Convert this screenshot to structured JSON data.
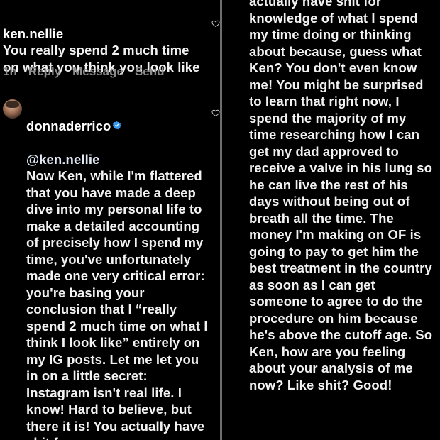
{
  "colors": {
    "background": "#000000",
    "text": "#f2f2f2",
    "meta": "#8e8e8e",
    "verified": "#3797f0",
    "divider": "#6e6e6e"
  },
  "comment1": {
    "username": "ken.nellie",
    "text": "You really spend 2 much time on what you think you look like",
    "time": "1h",
    "reply_label": "Reply",
    "message_label": "Message",
    "send_label": "Send",
    "like_icon": "heart-outline-icon"
  },
  "comment2": {
    "username": "donnaderrico",
    "verified_icon": "verified-badge-icon",
    "like_icon": "heart-outline-icon",
    "mention": "@ken.nellie",
    "text": "Now Ken, while I'm flattered that you have made a deep dive into my personal life to make a detailed accounting of precisely how I spend my time, you've unfortunately made one very critical error: you're basing your conclusion that I “really spend 2 much time on what I think I look like” entirely on my IG posts. Let me let you in on a little secret: Instagram isn't real life. I know! Hard to believe, but there it is! You actually have shit for",
    "continued_text": "actually have shit for knowledge of what I spend my time doing or thinking about because, guess what Ken? You don't even know me! You might be surprised to learn that right now, I spend the majority of my time researching how I can get my dad approved to receive a valve in his lung so he can live the rest of his days without being out of breath all the time. The money I'm making on OF is going to pay to get him the best treatment in the country as soon as I can get someone to agree to do the procedure on him because he's above the cutoff age. So Ken, how are you feeling about your analysis of me now? Like shit? Good!"
  }
}
